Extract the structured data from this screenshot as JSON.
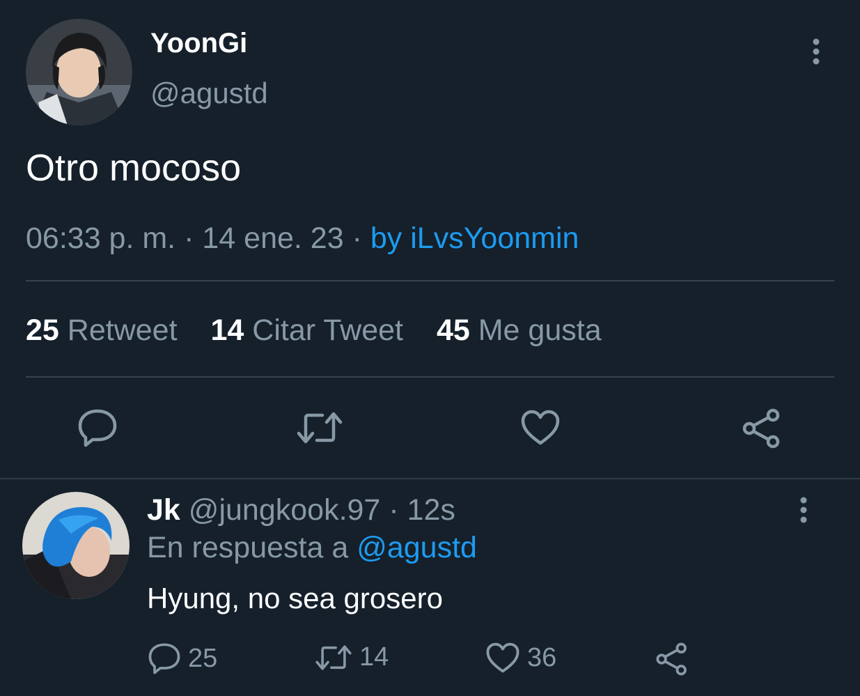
{
  "tweet": {
    "author_name": "YoonGi",
    "author_handle": "@agustd",
    "text": "Otro mocoso",
    "time": "06:33 p. m.",
    "date": "14 ene. 23",
    "dot": "·",
    "source": "by iLvsYoonmin",
    "stats": {
      "retweets_count": "25",
      "retweets_label": "Retweet",
      "quotes_count": "14",
      "quotes_label": "Citar Tweet",
      "likes_count": "45",
      "likes_label": "Me gusta"
    },
    "actions": [
      "reply-icon",
      "retweet-icon",
      "like-icon",
      "share-icon"
    ],
    "menu_icon": "more-vertical-icon"
  },
  "reply": {
    "author_name": "Jk",
    "author_handle": "@jungkook.97",
    "dot": "·",
    "age": "12s",
    "reply_prefix": "En respuesta a",
    "reply_to": "@agustd",
    "text": "Hyung, no sea grosero",
    "replies": "25",
    "retweets": "14",
    "likes": "36"
  },
  "colors": {
    "background": "#15202b",
    "muted": "#8899a6",
    "link": "#1d9bf0",
    "divider": "#38444d"
  }
}
